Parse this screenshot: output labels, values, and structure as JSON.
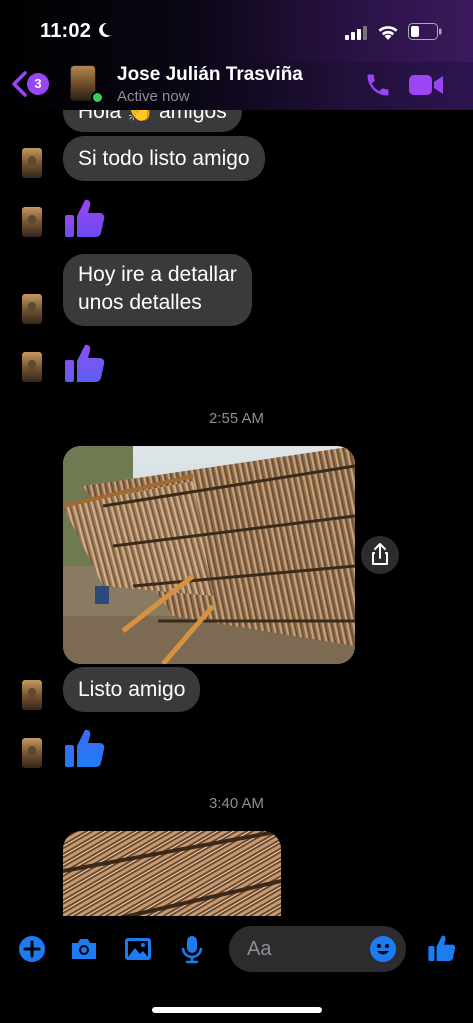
{
  "status_bar": {
    "time": "11:02"
  },
  "header": {
    "back_badge": "3",
    "contact_name": "Jose Julián Trasviña",
    "contact_status": "Active now"
  },
  "messages": {
    "partial_top": "Hola 👏 amigos",
    "m1": "Si todo listo amigo",
    "m2_line1": "Hoy ire a detallar",
    "m2_line2": "unos detalles",
    "ts1": "2:55 AM",
    "m3": "Listo amigo",
    "ts2": "3:40 AM"
  },
  "composer": {
    "placeholder": "Aa"
  },
  "colors": {
    "accent": "#9b46f5",
    "blue": "#1e7cf2",
    "bubble": "#3a3a3c",
    "background": "#000000"
  },
  "icons": [
    "moon-icon",
    "signal-icon",
    "wifi-icon",
    "battery-icon",
    "back-chevron-icon",
    "phone-icon",
    "video-icon",
    "thumbs-up-icon",
    "share-icon",
    "plus-icon",
    "camera-icon",
    "image-icon",
    "microphone-icon",
    "emoji-icon"
  ]
}
